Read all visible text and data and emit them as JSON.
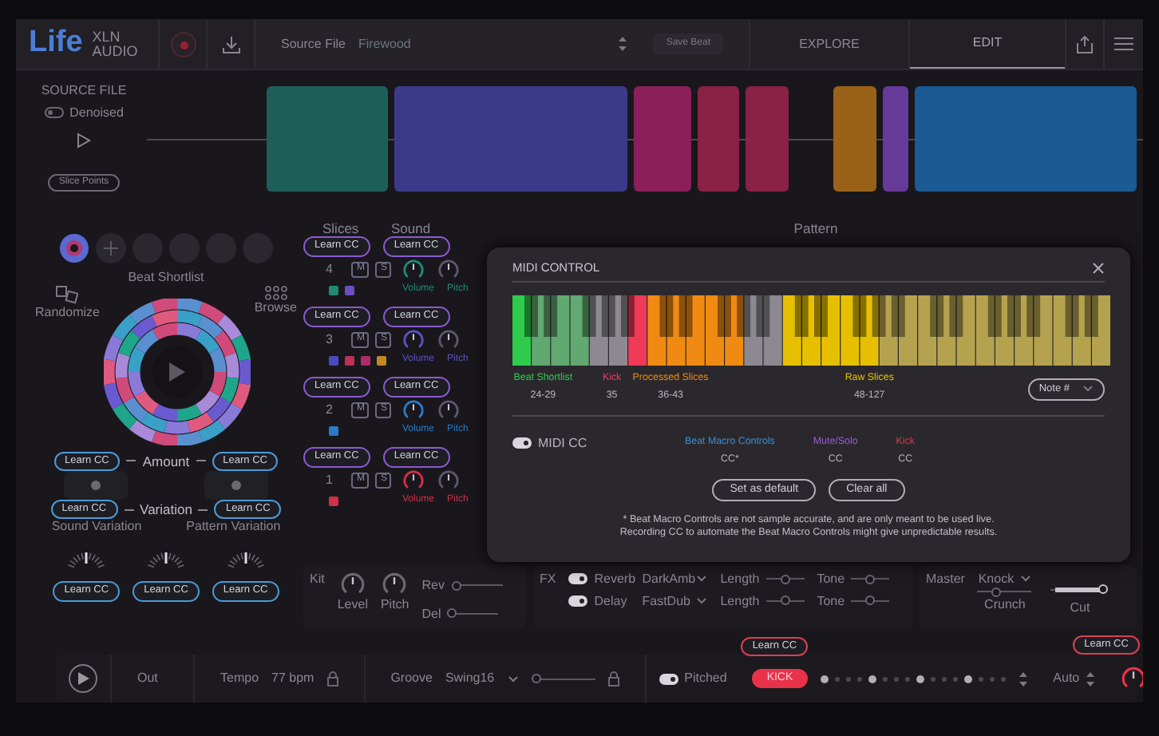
{
  "header": {
    "logo": "Life",
    "brand": [
      "XLN",
      "AUDIO"
    ],
    "source_label": "Source File",
    "source_name": "Firewood",
    "save_button": "Save Beat",
    "tabs": [
      {
        "label": "EXPLORE",
        "selected": false
      },
      {
        "label": "EDIT",
        "selected": true
      }
    ]
  },
  "source_file": {
    "title": "SOURCE FILE",
    "denoised": {
      "label": "Denoised",
      "on": false
    },
    "slice_points": "Slice Points",
    "slices": [
      {
        "color": "#1d5f58"
      },
      {
        "color": "#3b3a88"
      },
      {
        "color": "#8a1f5c"
      },
      {
        "color": "#8a2245"
      },
      {
        "color": "#8a2245"
      },
      {
        "color": "#9a6218"
      },
      {
        "color": "#653a98"
      },
      {
        "color": "#1b5a92"
      }
    ]
  },
  "beat_panel": {
    "shortlist_label": "Beat Shortlist",
    "randomize": "Randomize",
    "browse": "Browse",
    "amount": {
      "label": "Amount",
      "learn": [
        "Learn CC",
        "Learn CC"
      ]
    },
    "variation": {
      "label": "Variation",
      "learn": [
        "Learn CC",
        "Learn CC"
      ]
    },
    "sound_variation": "Sound Variation",
    "pattern_variation": "Pattern Variation",
    "dial_learn": [
      "Learn CC",
      "Learn CC",
      "Learn CC"
    ]
  },
  "slices_panel": {
    "headers": [
      "Slices",
      "Sound"
    ],
    "rows": [
      {
        "number": "4",
        "learn": [
          "Learn CC",
          "Learn CC"
        ],
        "mute": "M",
        "solo": "S",
        "color": "#1e8a78",
        "knob_labels": [
          "Volume",
          "Pitch"
        ],
        "swatches": [
          {
            "color": "#1e8a70"
          },
          {
            "color": "#6a4fc0"
          }
        ]
      },
      {
        "number": "3",
        "learn": [
          "Learn CC",
          "Learn CC"
        ],
        "mute": "M",
        "solo": "S",
        "color": "#5a52c0",
        "knob_labels": [
          "Volume",
          "Pitch"
        ],
        "swatches": [
          {
            "color": "#4a4ac0"
          },
          {
            "color": "#c0305a"
          },
          {
            "color": "#b02a6a"
          },
          {
            "color": "#c08a20"
          }
        ]
      },
      {
        "number": "2",
        "learn": [
          "Learn CC",
          "Learn CC"
        ],
        "mute": "M",
        "solo": "S",
        "color": "#2a7ac8",
        "knob_labels": [
          "Volume",
          "Pitch"
        ],
        "swatches": [
          {
            "color": "#2a7ac8"
          }
        ]
      },
      {
        "number": "1",
        "learn": [
          "Learn CC",
          "Learn CC"
        ],
        "mute": "M",
        "solo": "S",
        "color": "#d0304a",
        "knob_labels": [
          "Volume",
          "Pitch"
        ],
        "swatches": [
          {
            "color": "#d0304a"
          }
        ]
      }
    ]
  },
  "pattern_header": "Pattern",
  "kit": {
    "title": "Kit",
    "knobs": [
      "Level",
      "Pitch"
    ],
    "sliders": [
      {
        "label": "Rev",
        "level": 0
      },
      {
        "label": "Del",
        "level": 0
      }
    ]
  },
  "fx": {
    "title": "FX",
    "rows": [
      {
        "on": true,
        "name": "Reverb",
        "preset": "DarkAmb",
        "params": [
          {
            "label": "Length",
            "level": 0.5
          },
          {
            "label": "Tone",
            "level": 0.5
          }
        ]
      },
      {
        "on": true,
        "name": "Delay",
        "preset": "FastDub",
        "params": [
          {
            "label": "Length",
            "level": 0.5
          },
          {
            "label": "Tone",
            "level": 0.5
          }
        ]
      }
    ]
  },
  "master": {
    "title": "Master",
    "preset": "Knock",
    "crunch": {
      "label": "Crunch",
      "level": 0.3
    },
    "cut": {
      "label": "Cut",
      "level": 1
    }
  },
  "bottom_bar": {
    "out": "Out",
    "tempo_label": "Tempo",
    "tempo": "77 bpm",
    "groove_label": "Groove",
    "groove": "Swing16",
    "groove_slider": {
      "level": 0
    },
    "pitched": {
      "label": "Pitched",
      "on": true
    },
    "kick_learn": "Learn CC",
    "kick": "KICK",
    "steps": [
      {
        "on": true
      },
      {
        "on": false
      },
      {
        "on": false
      },
      {
        "on": false
      },
      {
        "on": true
      },
      {
        "on": false
      },
      {
        "on": false
      },
      {
        "on": false
      },
      {
        "on": true
      },
      {
        "on": false
      },
      {
        "on": false
      },
      {
        "on": false
      },
      {
        "on": true
      },
      {
        "on": false
      },
      {
        "on": false
      },
      {
        "on": false
      }
    ],
    "auto": "Auto",
    "knob_learn": "Learn CC"
  },
  "midi_dialog": {
    "title": "MIDI CONTROL",
    "zones": [
      {
        "label": "Beat Shortlist",
        "range": "24-29",
        "color": "#2ecc4a"
      },
      {
        "label": "Kick",
        "range": "35",
        "color": "#f03a58"
      },
      {
        "label": "Processed Slices",
        "range": "36-43",
        "color": "#f08a12"
      },
      {
        "label": "Raw Slices",
        "range": "48-127",
        "color": "#e6c000"
      }
    ],
    "mode_select": "Note #",
    "midi_cc": {
      "label": "MIDI CC",
      "on": true
    },
    "cc_groups": [
      {
        "label": "Beat Macro Controls",
        "value": "CC*",
        "color": "#3a8fd8"
      },
      {
        "label": "Mute/Solo",
        "value": "CC",
        "color": "#9a5ad8"
      },
      {
        "label": "Kick",
        "value": "CC",
        "color": "#d83a4a"
      }
    ],
    "buttons": [
      "Set as default",
      "Clear all"
    ],
    "note": [
      "* Beat Macro Controls are not sample accurate, and are only meant to be used live.",
      "Recording CC to automate the Beat Macro Controls might give unpredictable results."
    ]
  }
}
